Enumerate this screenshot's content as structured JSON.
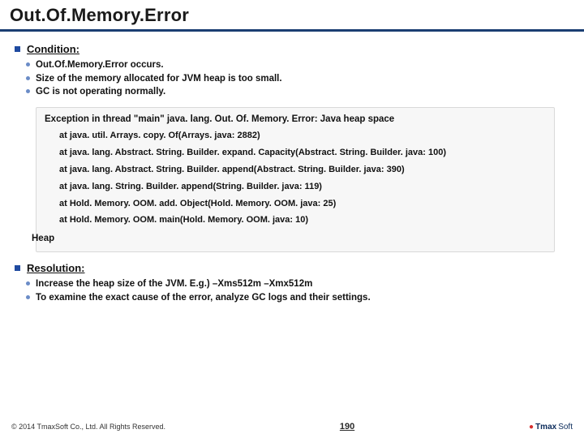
{
  "title": "Out.Of.Memory.Error",
  "sections": {
    "condition": {
      "heading": "Condition:",
      "bullets": [
        "Out.Of.Memory.Error occurs.",
        "Size of the memory allocated for JVM heap is too small.",
        "GC is not operating normally."
      ]
    },
    "resolution": {
      "heading": "Resolution:",
      "bullets": [
        "Increase the heap size of the JVM. E.g.) –Xms512m –Xmx512m",
        "To examine the exact cause of the error, analyze GC logs and their settings."
      ]
    }
  },
  "console": {
    "error_line": "Exception in thread \"main\" java. lang. Out. Of. Memory. Error: Java heap space",
    "trace": [
      "at java. util. Arrays. copy. Of(Arrays. java: 2882)",
      "at java. lang. Abstract. String. Builder. expand. Capacity(Abstract. String. Builder. java: 100)",
      "at java. lang. Abstract. String. Builder. append(Abstract. String. Builder. java: 390)",
      "at java. lang. String. Builder. append(String. Builder. java: 119)",
      "at Hold. Memory. OOM. add. Object(Hold. Memory. OOM. java: 25)",
      "at Hold. Memory. OOM. main(Hold. Memory. OOM. java: 10)"
    ],
    "heap_label": "Heap"
  },
  "footer": {
    "copyright": "© 2014 TmaxSoft Co., Ltd. All Rights Reserved.",
    "page_number": "190",
    "logo_text": "Tmax",
    "logo_suffix": "Soft"
  }
}
